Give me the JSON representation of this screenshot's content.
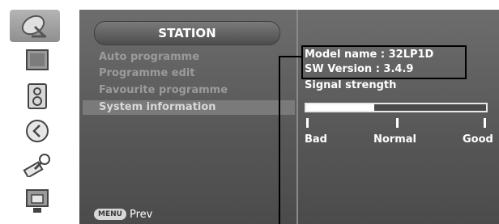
{
  "sidebar": {
    "icons": [
      {
        "name": "satellite-dish-icon"
      },
      {
        "name": "picture-icon"
      },
      {
        "name": "speaker-icon"
      },
      {
        "name": "clock-icon"
      },
      {
        "name": "tools-icon"
      },
      {
        "name": "screen-lock-icon"
      }
    ]
  },
  "menu": {
    "title": "STATION",
    "items": [
      {
        "label": "Auto programme"
      },
      {
        "label": "Programme edit"
      },
      {
        "label": "Favourite programme"
      },
      {
        "label": "System information"
      }
    ],
    "selected_index": 3,
    "footer": {
      "key": "MENU",
      "label": "Prev"
    }
  },
  "info": {
    "model_name": "Model name : 32LP1D",
    "sw_version": "SW Version : 3.4.9",
    "signal_label": "Signal strength",
    "signal_level": 0.38,
    "scale": {
      "bad": "Bad",
      "normal": "Normal",
      "good": "Good"
    }
  }
}
